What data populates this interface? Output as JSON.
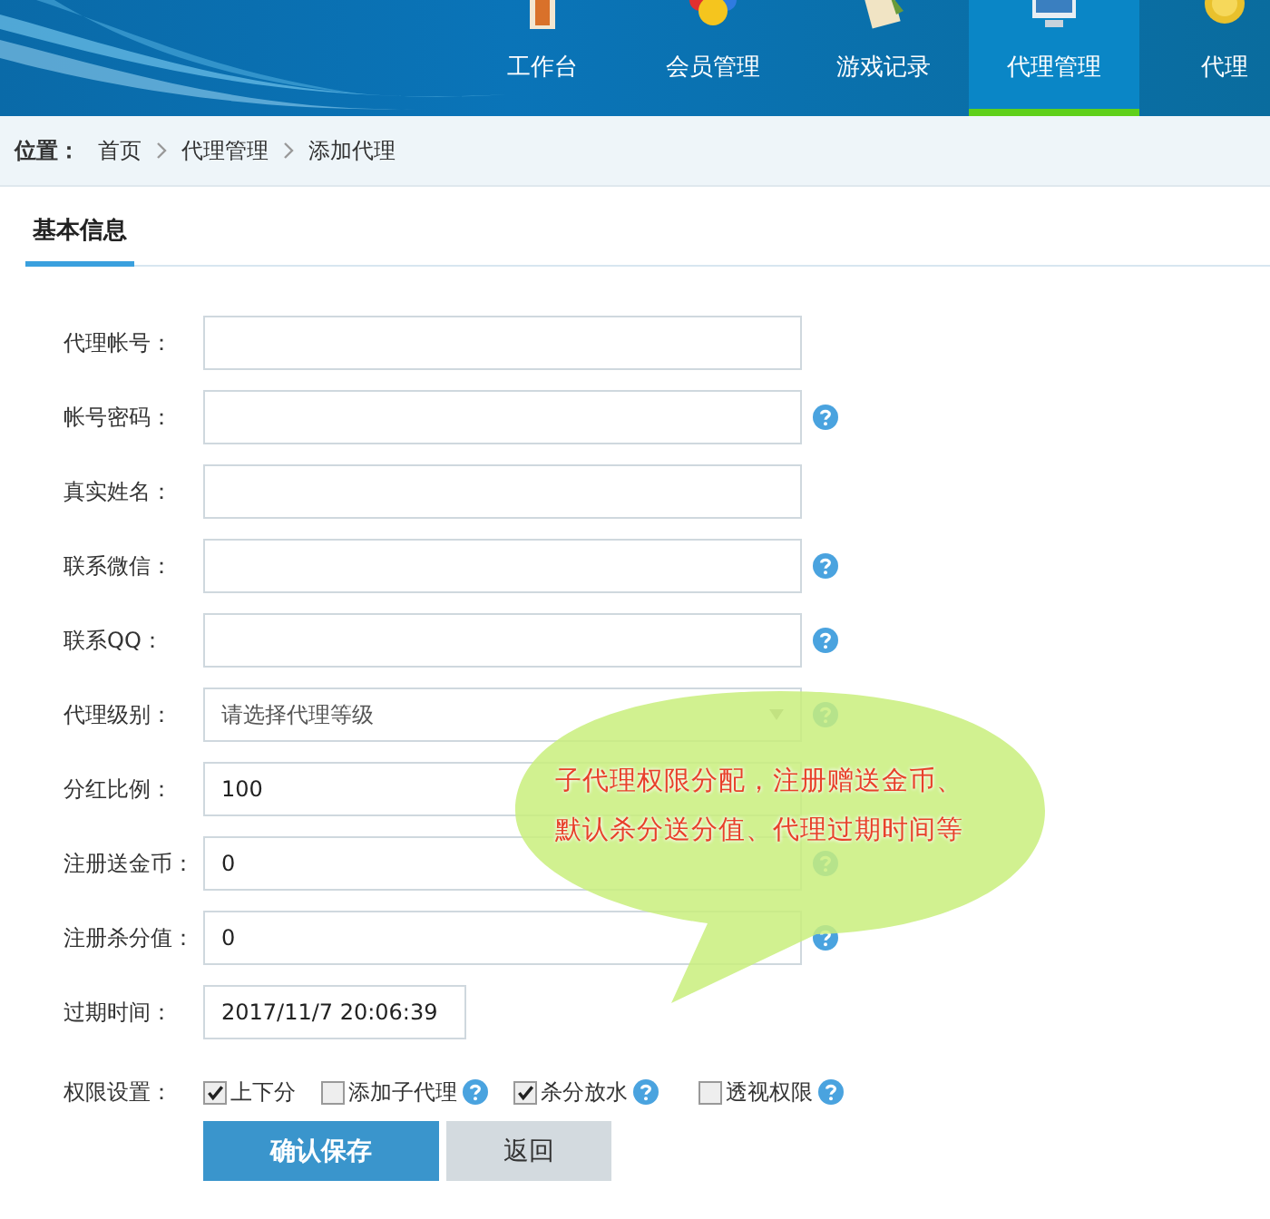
{
  "nav": [
    {
      "label": "工作台",
      "selected": false
    },
    {
      "label": "会员管理",
      "selected": false
    },
    {
      "label": "游戏记录",
      "selected": false
    },
    {
      "label": "代理管理",
      "selected": true
    },
    {
      "label": "代理",
      "selected": false
    }
  ],
  "breadcrumb": {
    "label": "位置：",
    "items": [
      "首页",
      "代理管理",
      "添加代理"
    ]
  },
  "section_title": "基本信息",
  "fields": [
    {
      "kind": "text",
      "label": "代理帐号：",
      "help": false
    },
    {
      "kind": "text",
      "label": "帐号密码：",
      "help": true
    },
    {
      "kind": "text",
      "label": "真实姓名：",
      "help": false
    },
    {
      "kind": "text",
      "label": "联系微信：",
      "help": true
    },
    {
      "kind": "text",
      "label": "联系QQ：",
      "help": true
    },
    {
      "kind": "select",
      "label": "代理级别：",
      "placeholder": "请选择代理等级",
      "help": true
    },
    {
      "kind": "text",
      "label": "分红比例：",
      "value": "100",
      "help": false
    },
    {
      "kind": "text",
      "label": "注册送金币：",
      "value": "0",
      "help": true
    },
    {
      "kind": "text",
      "label": "注册杀分值：",
      "value": "0",
      "help": true
    },
    {
      "kind": "date",
      "label": "过期时间：",
      "value": "2017/11/7 20:06:39",
      "help": false
    }
  ],
  "permissions": {
    "label": "权限设置：",
    "options": [
      {
        "label": "上下分",
        "checked": true,
        "help": false
      },
      {
        "label": "添加子代理",
        "checked": false,
        "help": true
      },
      {
        "label": "杀分放水",
        "checked": true,
        "help": true
      },
      {
        "label": "透视权限",
        "checked": false,
        "help": true
      }
    ]
  },
  "buttons": [
    {
      "kind": "primary",
      "label": "确认保存"
    },
    {
      "kind": "secondary",
      "label": "返回"
    }
  ],
  "callout": {
    "lines": [
      "子代理权限分配，注册赠送金币、",
      "默认杀分送分值、代理过期时间等"
    ]
  }
}
